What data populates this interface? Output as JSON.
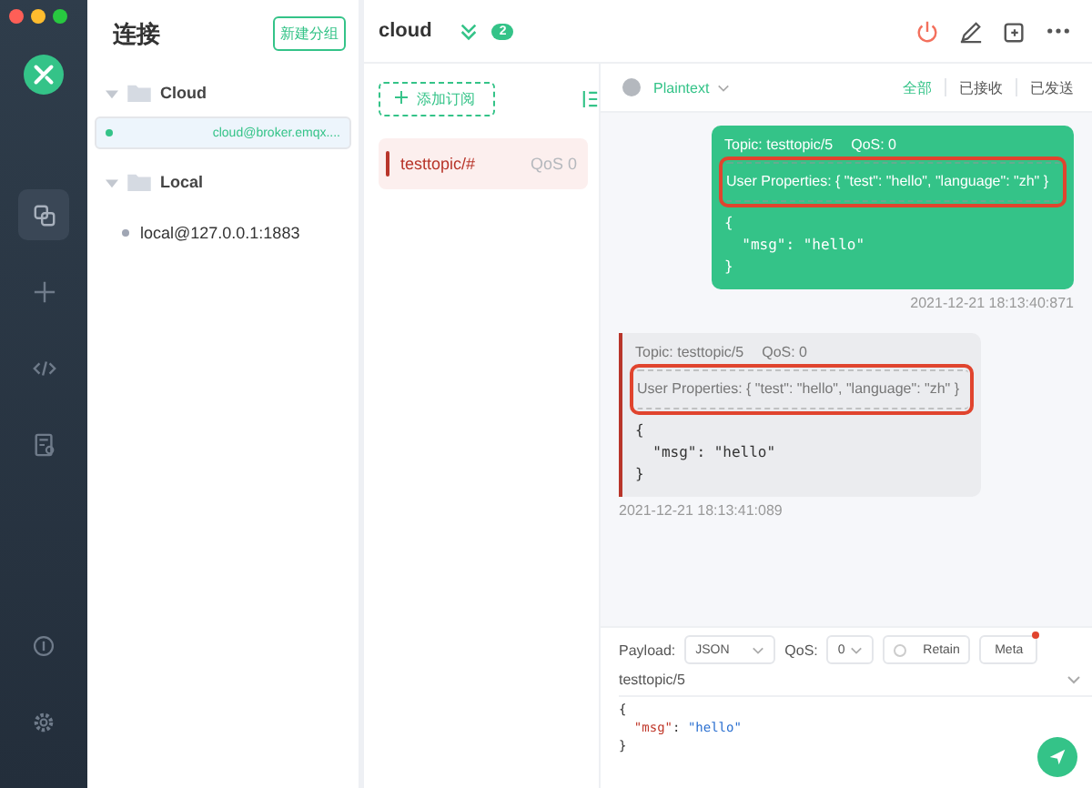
{
  "nav": [
    {
      "selected": true
    },
    {
      "selected": false
    },
    {
      "selected": false
    },
    {
      "selected": false
    }
  ],
  "connections": {
    "title": "连接",
    "new_group_button": "新建分组",
    "groups": [
      {
        "name": "Cloud",
        "expanded": true,
        "children": [
          {
            "name": "cloud@broker.emqx....",
            "selected": true,
            "color": "#34c388"
          }
        ]
      },
      {
        "name": "Local",
        "expanded": true,
        "children": [
          {
            "name": "local@127.0.0.1:1883",
            "selected": false,
            "color": "#a0a6b4"
          }
        ]
      }
    ]
  },
  "header": {
    "title": "cloud",
    "badge": "2"
  },
  "subscriptions": {
    "add_button": "添加订阅",
    "items": [
      {
        "topic": "testtopic/#",
        "qos": "QoS 0",
        "color": "#b8352a"
      }
    ]
  },
  "messages": {
    "format": "Plaintext",
    "filters": [
      {
        "label": "全部",
        "selected": true
      },
      {
        "label": "已接收",
        "selected": false
      },
      {
        "label": "已发送",
        "selected": false
      }
    ],
    "items": [
      {
        "kind": "sent",
        "topic": "Topic: testtopic/5",
        "qos": "QoS: 0",
        "properties": "User Properties: { \"test\": \"hello\", \"language\": \"zh\" }",
        "highlighted": true,
        "payload": "{\n  \"msg\": \"hello\"\n}",
        "time": "2021-12-21 18:13:40:871"
      },
      {
        "kind": "received",
        "topic": "Topic: testtopic/5",
        "qos": "QoS: 0",
        "properties": "User Properties: { \"test\": \"hello\", \"language\": \"zh\" }",
        "highlighted": true,
        "payload": "{\n  \"msg\": \"hello\"\n}",
        "time": "2021-12-21 18:13:41:089",
        "color": "#b8352a"
      }
    ]
  },
  "composer": {
    "payload_label": "Payload:",
    "payload_format": "JSON",
    "qos_label": "QoS:",
    "qos": "0",
    "retain": {
      "label": "Retain",
      "checked": false
    },
    "meta_button": "Meta",
    "meta_dot": true,
    "topic": "testtopic/5",
    "code": [
      [
        {
          "kind": "punct",
          "text": "{"
        }
      ],
      [
        {
          "kind": "key",
          "text": "  \"msg\""
        },
        {
          "kind": "punct",
          "text": ": "
        },
        {
          "kind": "value",
          "text": "\"hello\""
        }
      ],
      [
        {
          "kind": "punct",
          "text": "}"
        }
      ]
    ]
  }
}
